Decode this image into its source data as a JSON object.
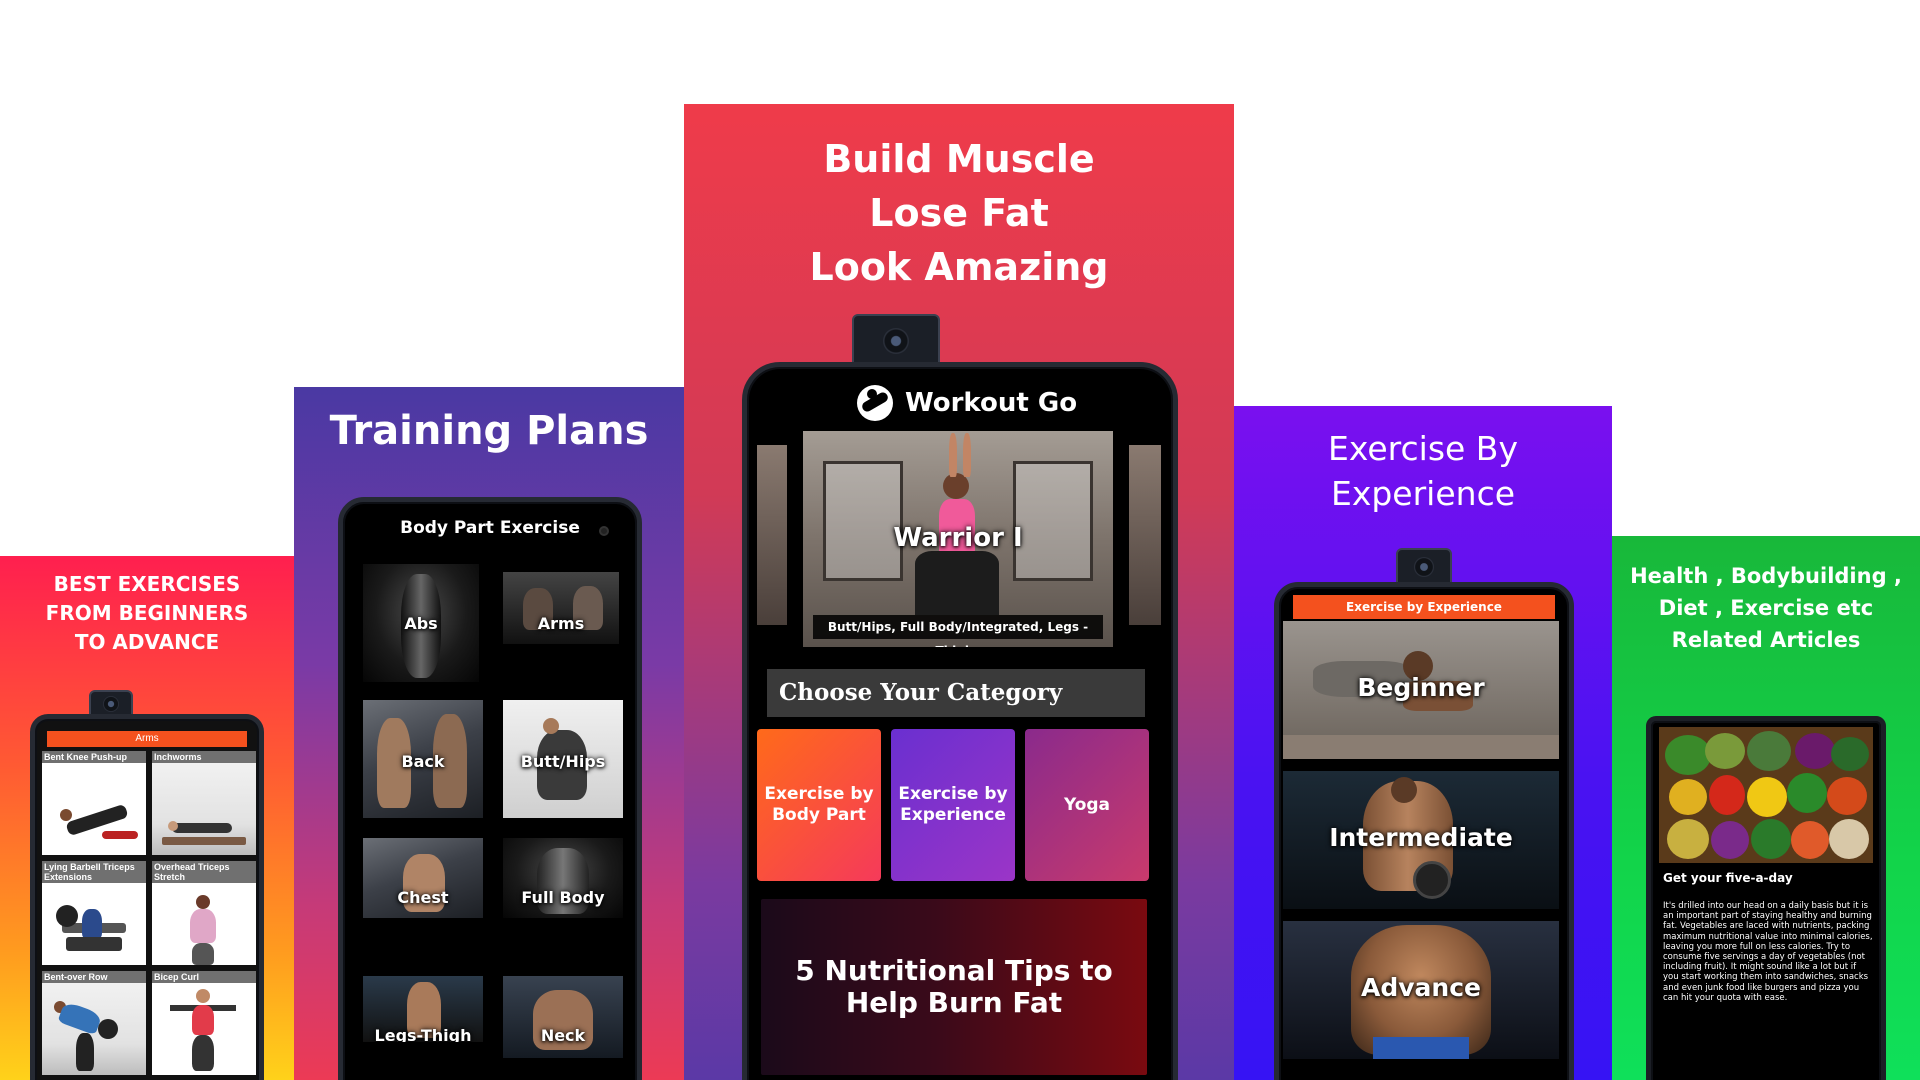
{
  "panel1": {
    "title_lines": [
      "BEST EXERCISES",
      "FROM BEGINNERS",
      "TO ADVANCE"
    ],
    "header": "Arms",
    "items": [
      {
        "label": "Bent Knee Push-up"
      },
      {
        "label": "Inchworms"
      },
      {
        "label": "Lying Barbell Triceps Extensions"
      },
      {
        "label": "Overhead Triceps Stretch"
      },
      {
        "label": "Bent-over Row"
      },
      {
        "label": "Bicep Curl"
      }
    ]
  },
  "panel2": {
    "title": "Training Plans",
    "header": "Body Part Exercise",
    "items": [
      {
        "label": "Abs"
      },
      {
        "label": "Arms"
      },
      {
        "label": "Back"
      },
      {
        "label": "Butt/Hips"
      },
      {
        "label": "Chest"
      },
      {
        "label": "Full Body"
      },
      {
        "label": "Legs-Thigh"
      },
      {
        "label": "Neck"
      }
    ]
  },
  "panel3": {
    "title_lines": [
      "Build Muscle",
      "Lose Fat",
      "Look Amazing"
    ],
    "app_name": "Workout Go",
    "featured": {
      "title": "Warrior I",
      "tags": "Butt/Hips, Full Body/Integrated, Legs - Thighs"
    },
    "category_heading": "Choose Your Category",
    "categories": [
      {
        "label": "Exercise by Body Part"
      },
      {
        "label": "Exercise by Experience"
      },
      {
        "label": "Yoga"
      }
    ],
    "article_banner": "5 Nutritional Tips to Help Burn Fat"
  },
  "panel4": {
    "title_lines": [
      "Exercise By",
      "Experience"
    ],
    "header": "Exercise by Experience",
    "levels": [
      {
        "label": "Beginner"
      },
      {
        "label": "Intermediate"
      },
      {
        "label": "Advance"
      }
    ]
  },
  "panel5": {
    "title_lines": [
      "Health , Bodybuilding ,",
      "Diet , Exercise etc",
      "Related Articles"
    ],
    "article_title": "Get your five-a-day",
    "article_body": "It's drilled into our head on a daily basis but it is an important part of staying healthy and burning fat. Vegetables are laced with nutrients, packing maximum nutritional value into minimal calories, leaving you more full on less calories. Try to consume five servings a day of vegetables (not including fruit). It might sound like a lot but if you start working them into sandwiches, snacks and even junk food like burgers and pizza you can hit your quota with ease."
  },
  "colors": {
    "orange_header": "#f4511e",
    "red": "#ee3a4a",
    "purple": "#7a12f0",
    "green": "#18c934"
  }
}
